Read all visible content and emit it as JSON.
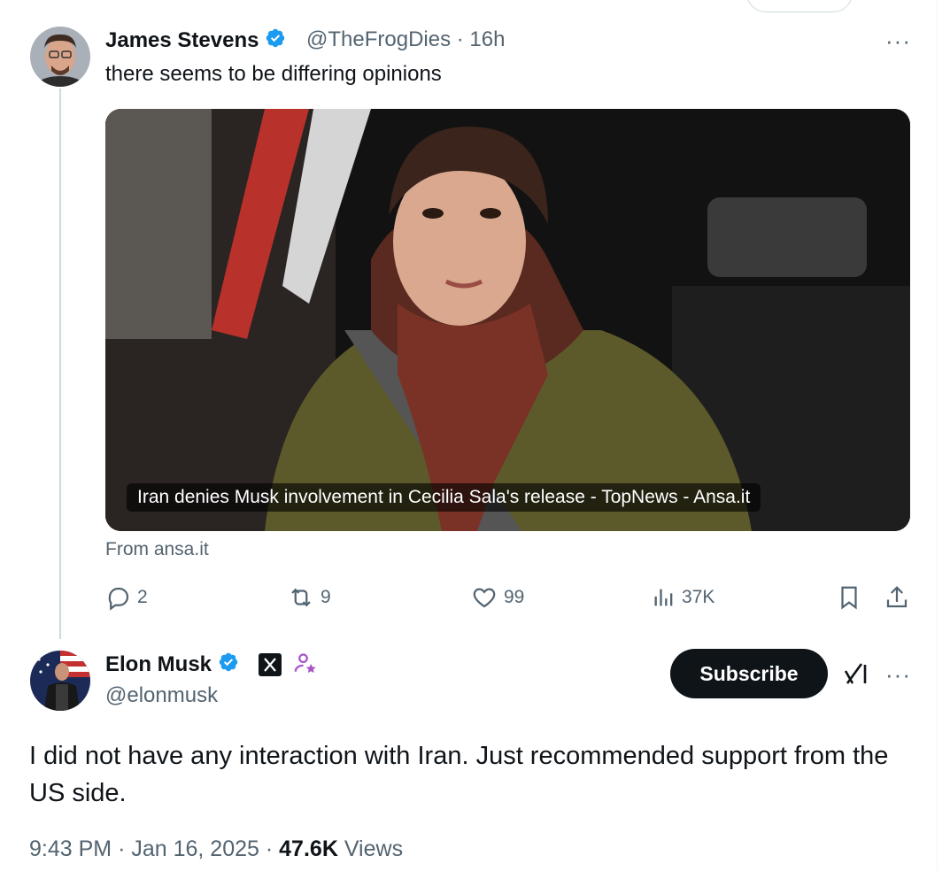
{
  "reply_tweet": {
    "author_name": "James Stevens",
    "handle": "@TheFrogDies",
    "separator": "·",
    "time": "16h",
    "text": "there seems to be differing opinions",
    "media": {
      "caption": "Iran denies Musk involvement in Cecilia Sala's release - TopNews - Ansa.it",
      "source": "From ansa.it"
    },
    "actions": {
      "replies": "2",
      "reposts": "9",
      "likes": "99",
      "views": "37K"
    }
  },
  "main_tweet": {
    "author_name": "Elon Musk",
    "handle": "@elonmusk",
    "subscribe_label": "Subscribe",
    "text": "I did not have any interaction with Iran. Just recommended support from the US side.",
    "time": "9:43 PM",
    "dot": "·",
    "date": "Jan 16, 2025",
    "views_count": "47.6K",
    "views_label": "Views"
  },
  "icons": {
    "verified": "verified-badge-icon",
    "more": "more-icon",
    "reply": "reply-icon",
    "repost": "repost-icon",
    "like": "heart-icon",
    "views": "analytics-icon",
    "bookmark": "bookmark-icon",
    "share": "share-icon",
    "grok": "grok-icon",
    "x_affiliate": "x-logo-icon",
    "creator": "creator-icon"
  },
  "colors": {
    "verified_blue": "#1d9bf0",
    "secondary_text": "#536471",
    "primary_text": "#0f1419",
    "subscribe_bg": "#0f1419",
    "creator_purple": "#a855c8"
  }
}
